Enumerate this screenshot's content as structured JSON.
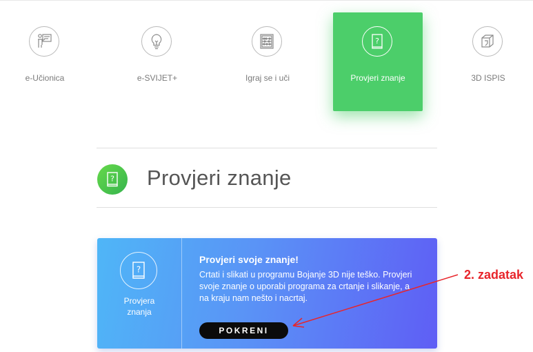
{
  "nav": {
    "items": [
      {
        "label": "e-Učionica",
        "icon": "teacher-board-icon",
        "active": false
      },
      {
        "label": "e-SVIJET+",
        "icon": "lightbulb-icon",
        "active": false
      },
      {
        "label": "Igraj se i uči",
        "icon": "abacus-icon",
        "active": false
      },
      {
        "label": "Provjeri znanje",
        "icon": "question-book-icon",
        "active": true
      },
      {
        "label": "3D ISPIS",
        "icon": "cube-icon",
        "active": false
      }
    ]
  },
  "section": {
    "title": "Provjeri znanje",
    "icon": "question-book-icon"
  },
  "card": {
    "side_label_line1": "Provjera",
    "side_label_line2": "znanja",
    "title": "Provjeri svoje znanje!",
    "description": "Crtati i slikati u programu Bojanje 3D nije teško. Provjeri svoje znanje o uporabi programa za crtanje i slikanje, a na kraju nam nešto i nacrtaj.",
    "button_label": "POKRENI"
  },
  "annotation": {
    "text": "2. zadatak"
  },
  "colors": {
    "active_green": "#4cce6a",
    "annotation_red": "#e8252b",
    "button_black": "#0b0b0b"
  }
}
